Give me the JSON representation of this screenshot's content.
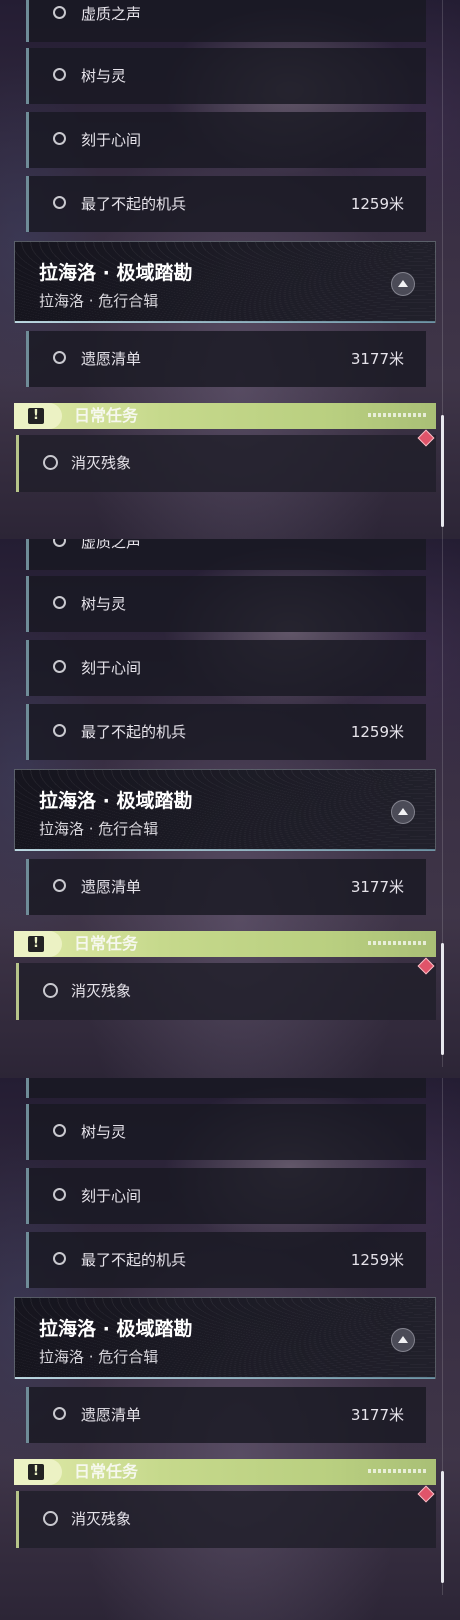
{
  "quests_main": [
    {
      "label": "虚质之声",
      "distance": ""
    },
    {
      "label": "树与灵",
      "distance": ""
    },
    {
      "label": "刻于心间",
      "distance": ""
    },
    {
      "label": "最了不起的机兵",
      "distance": "1259米"
    }
  ],
  "region": {
    "title": "拉海洛 · 极域踏勘",
    "subtitle": "拉海洛 · 危行合辑",
    "quest": {
      "label": "遗愿清单",
      "distance": "3177米"
    }
  },
  "daily": {
    "title": "日常任务",
    "icon_glyph": "!",
    "quest": {
      "label": "消灭残象"
    }
  },
  "colors": {
    "daily_accent": "#c6d98c",
    "tracked_marker": "#e0546a"
  },
  "icons": [
    "circle-check-icon",
    "collapse-arrow-icon",
    "alert-icon",
    "diamond-marker-icon"
  ]
}
